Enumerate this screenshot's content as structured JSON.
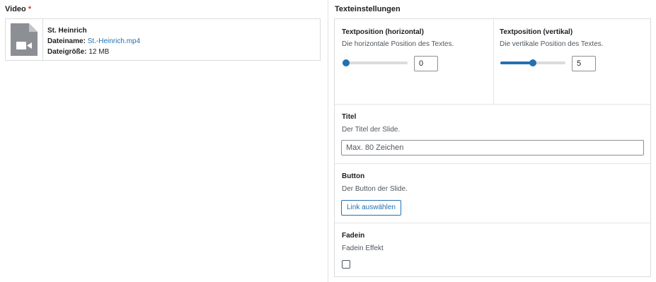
{
  "video": {
    "label": "Video",
    "required_mark": "*",
    "card": {
      "icon": "video-file-icon",
      "title": "St. Heinrich",
      "filename_label": "Dateiname:",
      "filename_value": "St.-Heinrich.mp4",
      "filesize_label": "Dateigröße:",
      "filesize_value": "12 MB"
    }
  },
  "text_settings": {
    "label": "Texteinstellungen",
    "horizontal": {
      "title": "Textposition (horizontal)",
      "description": "Die horizontale Position des Textes.",
      "value": "0",
      "slider_fraction": 0.0
    },
    "vertical": {
      "title": "Textposition (vertikal)",
      "description": "Die vertikale Position des Textes.",
      "value": "5",
      "slider_fraction": 0.5
    },
    "title_field": {
      "title": "Titel",
      "description": "Der Titel der Slide.",
      "placeholder": "Max. 80 Zeichen"
    },
    "button_field": {
      "title": "Button",
      "description": "Der Button der Slide.",
      "button_label": "Link auswählen"
    },
    "fadein_field": {
      "title": "Fadein",
      "description": "Fadein Effekt",
      "checked": false
    }
  },
  "colors": {
    "accent": "#2271b1",
    "required": "#d63638",
    "border": "#dcdcde"
  }
}
